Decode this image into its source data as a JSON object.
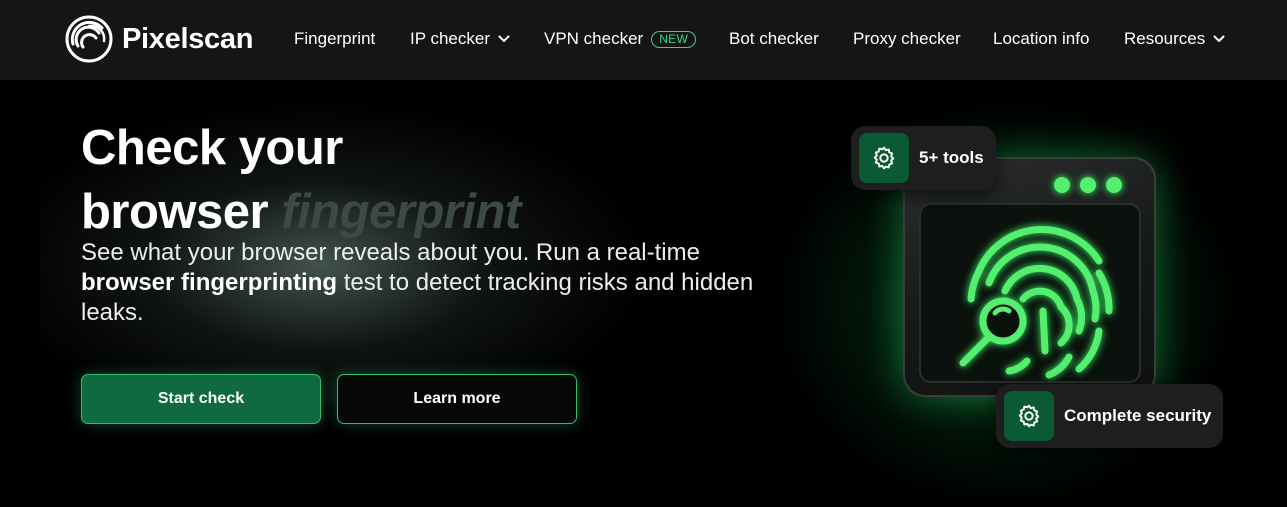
{
  "brand": {
    "name": "Pixelscan",
    "logo_icon": "pixelscan-logo-icon"
  },
  "nav": {
    "items": [
      {
        "label": "Fingerprint",
        "dropdown": false
      },
      {
        "label": "IP checker",
        "dropdown": true
      },
      {
        "label": "VPN checker",
        "dropdown": false,
        "badge": "NEW"
      },
      {
        "label": "Bot checker",
        "dropdown": false
      },
      {
        "label": "Proxy checker",
        "dropdown": false
      },
      {
        "label": "Location info",
        "dropdown": false
      },
      {
        "label": "Resources",
        "dropdown": true
      }
    ]
  },
  "hero": {
    "title_line1": "Check your",
    "title_line2_plain": "browser",
    "title_line2_accent": "fingerprint",
    "desc_part1": "See what your browser reveals about you. Run a real-time",
    "desc_bold": "browser fingerprinting",
    "desc_part2": "test to detect tracking risks and hidden leaks.",
    "primary_button": "Start check",
    "secondary_button": "Learn more"
  },
  "illustration": {
    "chip_tools": "5+ tools",
    "chip_security": "Complete security",
    "icons": [
      "gear-icon",
      "fingerprint-icon",
      "magnifier-icon"
    ]
  },
  "colors": {
    "nav_bg": "#151515",
    "page_bg": "#000000",
    "accent_green": "#2fbf72",
    "button_green": "#0f6a3f",
    "badge_green": "#3fd08a",
    "fingerprint_green": "#55ef70"
  }
}
